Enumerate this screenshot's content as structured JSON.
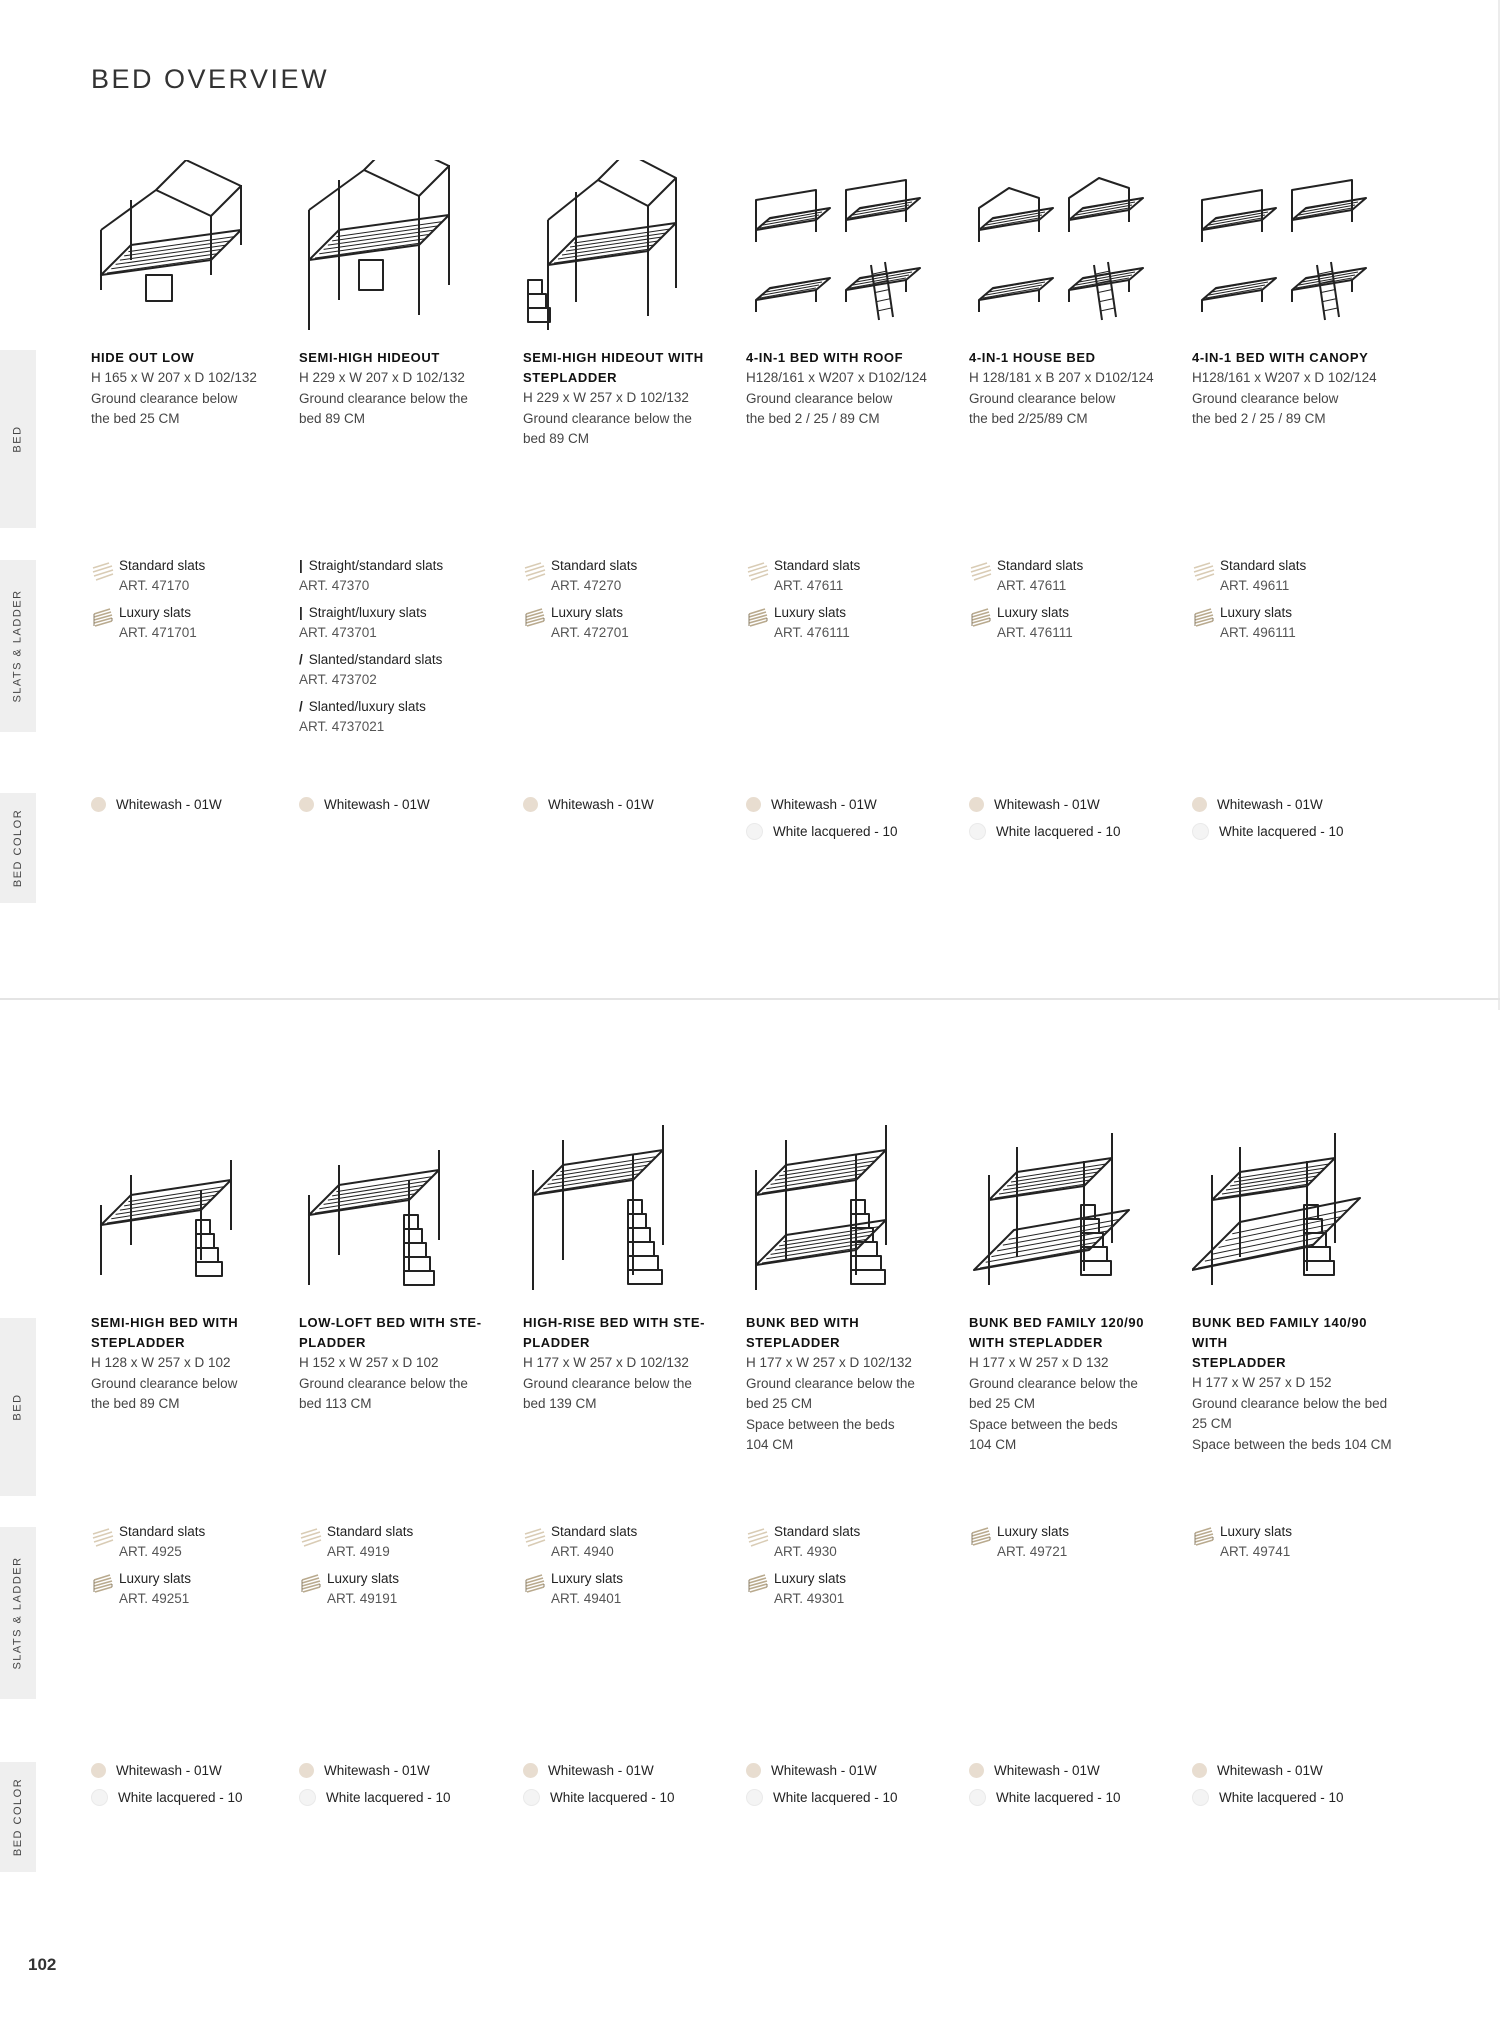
{
  "page": {
    "title": "BED OVERVIEW",
    "page_number": "102",
    "side_tabs": {
      "bed": "BED",
      "slats": "SLATS & LADDER",
      "color": "BED COLOR"
    }
  },
  "color_palette": {
    "whitewash": "#e8ddd0",
    "white_lacquered": "#f4f4f4"
  },
  "top_section": {
    "products": [
      {
        "name_lines": [
          "HIDE OUT LOW"
        ],
        "spec_lines": [
          "H 165 x W 207 x D 102/132",
          "Ground clearance below",
          "the bed 25 CM"
        ],
        "illustration": "hideout-low-bed-icon",
        "slats": [
          {
            "icon": "standard-slats-icon",
            "name": "Standard slats",
            "art": "ART. 47170"
          },
          {
            "icon": "luxury-slats-icon",
            "name": "Luxury slats",
            "art": "ART. 471701"
          }
        ],
        "colors": [
          {
            "swatch": "whitewash",
            "label": "Whitewash - 01W"
          }
        ]
      },
      {
        "name_lines": [
          "SEMI-HIGH HIDEOUT"
        ],
        "spec_lines": [
          "H 229 x W 207 x D 102/132",
          "Ground clearance below the",
          "bed 89 CM"
        ],
        "illustration": "semi-high-hideout-icon",
        "slats": [
          {
            "icon": "straight-mark",
            "mark": "|",
            "name": "Straight/standard slats",
            "art": "ART. 47370"
          },
          {
            "icon": "straight-mark",
            "mark": "|",
            "name": "Straight/luxury slats",
            "art": "ART. 473701"
          },
          {
            "icon": "slanted-mark",
            "mark": "/",
            "name": "Slanted/standard slats",
            "art": "ART. 473702"
          },
          {
            "icon": "slanted-mark",
            "mark": "/",
            "name": "Slanted/luxury slats",
            "art": "ART. 4737021"
          }
        ],
        "colors": [
          {
            "swatch": "whitewash",
            "label": "Whitewash - 01W"
          }
        ]
      },
      {
        "name_lines": [
          "SEMI-HIGH HIDEOUT WITH",
          "STEPLADDER"
        ],
        "spec_lines": [
          "H 229 x W 257 x D 102/132",
          "Ground clearance below the",
          "bed 89 CM"
        ],
        "illustration": "semi-high-hideout-stepladder-icon",
        "slats": [
          {
            "icon": "standard-slats-icon",
            "name": "Standard slats",
            "art": "ART. 47270"
          },
          {
            "icon": "luxury-slats-icon",
            "name": "Luxury slats",
            "art": "ART. 472701"
          }
        ],
        "colors": [
          {
            "swatch": "whitewash",
            "label": "Whitewash - 01W"
          }
        ]
      },
      {
        "name_lines": [
          "4-IN-1 BED WITH ROOF"
        ],
        "spec_lines": [
          "H128/161 x W207 x D102/124",
          "Ground clearance below",
          "the bed 2 / 25 / 89 CM"
        ],
        "illustration": "four-in-one-roof-icon",
        "slats": [
          {
            "icon": "standard-slats-icon",
            "name": "Standard slats",
            "art": "ART. 47611"
          },
          {
            "icon": "luxury-slats-icon",
            "name": "Luxury slats",
            "art": "ART. 476111"
          }
        ],
        "colors": [
          {
            "swatch": "whitewash",
            "label": "Whitewash - 01W"
          },
          {
            "swatch": "white_lacquered",
            "label": "White lacquered - 10"
          }
        ]
      },
      {
        "name_lines": [
          "4-IN-1 HOUSE BED"
        ],
        "spec_lines": [
          "H 128/181 x B 207 x D102/124",
          "Ground clearance below",
          "the bed 2/25/89 CM"
        ],
        "illustration": "four-in-one-house-icon",
        "slats": [
          {
            "icon": "standard-slats-icon",
            "name": "Standard slats",
            "art": "ART. 47611"
          },
          {
            "icon": "luxury-slats-icon",
            "name": "Luxury slats",
            "art": "ART. 476111"
          }
        ],
        "colors": [
          {
            "swatch": "whitewash",
            "label": "Whitewash - 01W"
          },
          {
            "swatch": "white_lacquered",
            "label": "White lacquered - 10"
          }
        ]
      },
      {
        "name_lines": [
          "4-IN-1 BED WITH CANOPY"
        ],
        "spec_lines": [
          "H128/161 x W207 x D 102/124",
          "Ground clearance below",
          "the bed 2 / 25 / 89 CM"
        ],
        "illustration": "four-in-one-canopy-icon",
        "slats": [
          {
            "icon": "standard-slats-icon",
            "name": "Standard slats",
            "art": "ART. 49611"
          },
          {
            "icon": "luxury-slats-icon",
            "name": "Luxury slats",
            "art": "ART. 496111"
          }
        ],
        "colors": [
          {
            "swatch": "whitewash",
            "label": "Whitewash - 01W"
          },
          {
            "swatch": "white_lacquered",
            "label": "White lacquered - 10"
          }
        ]
      }
    ]
  },
  "bottom_section": {
    "products": [
      {
        "name_lines": [
          "SEMI-HIGH BED WITH",
          "STEPLADDER"
        ],
        "spec_lines": [
          "H 128 x W 257 x D 102",
          "Ground clearance below",
          "the bed 89 CM"
        ],
        "illustration": "semi-high-stepladder-icon",
        "slats": [
          {
            "icon": "standard-slats-icon",
            "name": "Standard slats",
            "art": "ART. 4925"
          },
          {
            "icon": "luxury-slats-icon",
            "name": "Luxury slats",
            "art": "ART. 49251"
          }
        ],
        "colors": [
          {
            "swatch": "whitewash",
            "label": "Whitewash - 01W"
          },
          {
            "swatch": "white_lacquered",
            "label": "White lacquered - 10"
          }
        ]
      },
      {
        "name_lines": [
          "LOW-LOFT BED WITH STE-",
          "PLADDER"
        ],
        "spec_lines": [
          "H 152 x W 257 x D 102",
          "Ground clearance below the",
          "bed 113 CM"
        ],
        "illustration": "low-loft-stepladder-icon",
        "slats": [
          {
            "icon": "standard-slats-icon",
            "name": "Standard slats",
            "art": "ART. 4919"
          },
          {
            "icon": "luxury-slats-icon",
            "name": "Luxury slats",
            "art": "ART. 49191"
          }
        ],
        "colors": [
          {
            "swatch": "whitewash",
            "label": "Whitewash - 01W"
          },
          {
            "swatch": "white_lacquered",
            "label": "White lacquered - 10"
          }
        ]
      },
      {
        "name_lines": [
          "HIGH-RISE BED WITH STE-",
          "PLADDER"
        ],
        "spec_lines": [
          "H 177 x W 257 x D 102/132",
          "Ground clearance below the",
          "bed 139 CM"
        ],
        "illustration": "high-rise-stepladder-icon",
        "slats": [
          {
            "icon": "standard-slats-icon",
            "name": "Standard slats",
            "art": "ART. 4940"
          },
          {
            "icon": "luxury-slats-icon",
            "name": "Luxury slats",
            "art": "ART. 49401"
          }
        ],
        "colors": [
          {
            "swatch": "whitewash",
            "label": "Whitewash - 01W"
          },
          {
            "swatch": "white_lacquered",
            "label": "White lacquered - 10"
          }
        ]
      },
      {
        "name_lines": [
          "BUNK BED WITH",
          "STEPLADDER"
        ],
        "spec_lines": [
          "H 177 x W 257 x D 102/132",
          "Ground clearance below the",
          "bed 25 CM",
          "Space between the beds",
          "104 CM"
        ],
        "illustration": "bunk-bed-stepladder-icon",
        "slats": [
          {
            "icon": "standard-slats-icon",
            "name": "Standard slats",
            "art": "ART. 4930"
          },
          {
            "icon": "luxury-slats-icon",
            "name": "Luxury slats",
            "art": "ART. 49301"
          }
        ],
        "colors": [
          {
            "swatch": "whitewash",
            "label": "Whitewash - 01W"
          },
          {
            "swatch": "white_lacquered",
            "label": "White lacquered - 10"
          }
        ]
      },
      {
        "name_lines": [
          "BUNK BED FAMILY 120/90",
          "WITH STEPLADDER"
        ],
        "spec_lines": [
          "H 177 x W 257 x D 132",
          "Ground clearance below the",
          "bed 25 CM",
          "Space between the beds",
          "104 CM"
        ],
        "illustration": "bunk-family-120-icon",
        "slats": [
          {
            "icon": "luxury-slats-icon",
            "name": "Luxury slats",
            "art": "ART. 49721"
          }
        ],
        "colors": [
          {
            "swatch": "whitewash",
            "label": "Whitewash - 01W"
          },
          {
            "swatch": "white_lacquered",
            "label": "White lacquered - 10"
          }
        ]
      },
      {
        "name_lines": [
          "BUNK BED FAMILY 140/90 WITH",
          "STEPLADDER"
        ],
        "spec_lines": [
          "H 177 x W 257 x D 152",
          "Ground clearance below the bed 25 CM",
          "Space between the beds 104 CM"
        ],
        "illustration": "bunk-family-140-icon",
        "slats": [
          {
            "icon": "luxury-slats-icon",
            "name": "Luxury slats",
            "art": "ART. 49741"
          }
        ],
        "colors": [
          {
            "swatch": "whitewash",
            "label": "Whitewash - 01W"
          },
          {
            "swatch": "white_lacquered",
            "label": "White lacquered - 10"
          }
        ]
      }
    ]
  }
}
